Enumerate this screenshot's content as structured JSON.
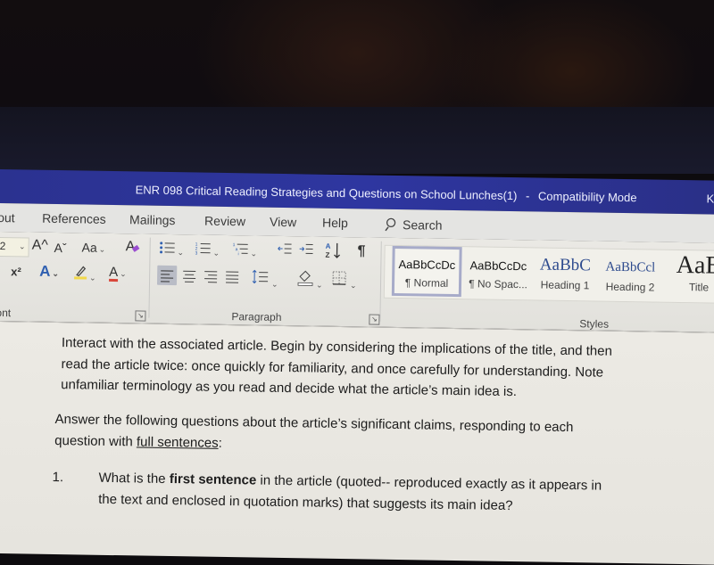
{
  "window": {
    "title": "ENR 098 Critical Reading Strategies and Questions on School Lunches(1)",
    "separator": "-",
    "mode": "Compatibility Mode",
    "right_glyph": "K"
  },
  "ribbon_tabs": [
    {
      "label": "out"
    },
    {
      "label": "References"
    },
    {
      "label": "Mailings"
    },
    {
      "label": "Review"
    },
    {
      "label": "View"
    },
    {
      "label": "Help"
    }
  ],
  "search": {
    "label": "Search",
    "icon": "lightbulb-search-icon"
  },
  "font_group": {
    "label": "ont",
    "size_value": "2",
    "grow_font": "A^",
    "shrink_font": "Aˇ",
    "change_case": "Aa",
    "clear_format": "A",
    "superscript": "x²",
    "text_effects": "A",
    "font_color": "A",
    "highlight_color": "#f1d84a",
    "font_color_swatch": "#d9463a"
  },
  "paragraph_group": {
    "label": "Paragraph",
    "sort": "A↓Z",
    "show_marks": "¶"
  },
  "styles_group": {
    "label": "Styles",
    "items": [
      {
        "sample": "AaBbCcDc",
        "name": "¶ Normal",
        "active": true
      },
      {
        "sample": "AaBbCcDc",
        "name": "¶ No Spac..."
      },
      {
        "sample": "AaBbC",
        "name": "Heading 1"
      },
      {
        "sample": "AaBbCcl",
        "name": "Heading 2"
      },
      {
        "sample": "AaB",
        "name": "Title"
      }
    ]
  },
  "document": {
    "intro_lines": [
      "Interact with the associated article.  Begin by considering the implications of the title, and then",
      "read the article twice: once quickly for familiarity, and once carefully for understanding.  Note",
      "unfamiliar terminology as you read and decide what the article’s main idea is."
    ],
    "instructions_line1": "Answer the following questions about the article’s significant claims, responding to each",
    "instructions_line2_prefix": "question with ",
    "instructions_line2_underlined": "full sentences",
    "instructions_line2_suffix": ":",
    "question": {
      "number": "1.",
      "line1_prefix": "What is the ",
      "line1_bold": "first sentence",
      "line1_suffix": " in the article (quoted-- reproduced exactly as it appears in",
      "line2": "the text and enclosed in quotation marks) that suggests its main idea?"
    }
  }
}
